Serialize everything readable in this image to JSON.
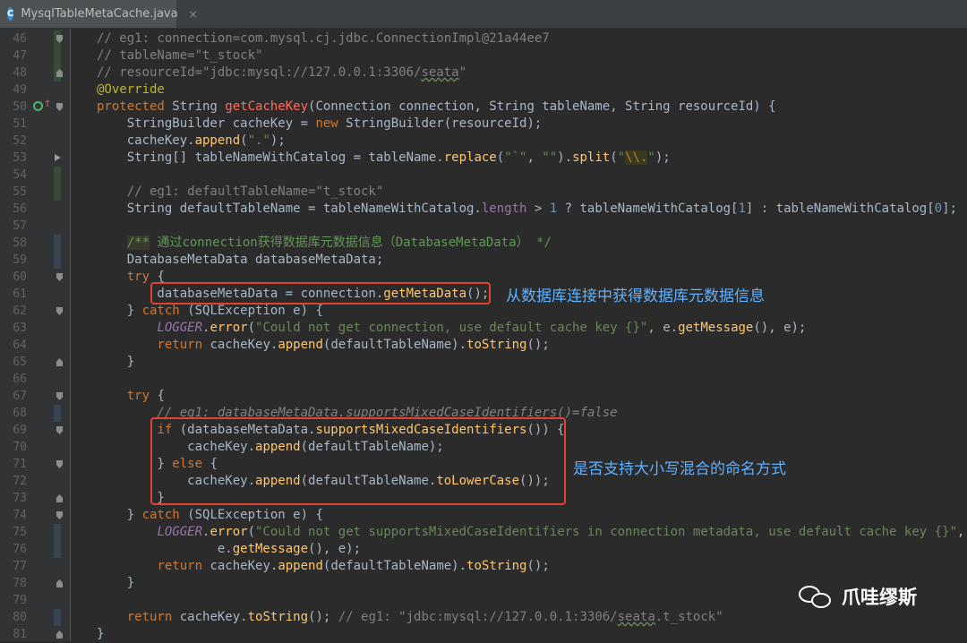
{
  "tab": {
    "icon": "C",
    "title": "MysqlTableMetaCache.java",
    "close": "×"
  },
  "gutter": {
    "line_numbers": [
      "46",
      "47",
      "48",
      "49",
      "50",
      "51",
      "52",
      "53",
      "54",
      "55",
      "56",
      "57",
      "58",
      "59",
      "60",
      "61",
      "62",
      "63",
      "64",
      "65",
      "66",
      "67",
      "68",
      "69",
      "70",
      "71",
      "72",
      "73",
      "74",
      "75",
      "76",
      "77",
      "78",
      "79",
      "80",
      "81"
    ]
  },
  "code": {
    "l46": "// eg1: connection=com.mysql.cj.jdbc.ConnectionImpl@21a44ee7",
    "l47": "// tableName=\"t_stock\"",
    "l48a": "// resourceId=\"jdbc:mysql://127.0.0.1:3306/",
    "l48b": "seata",
    "l48c": "\"",
    "l49": "@Override",
    "l50a": "protected",
    "l50b": " String ",
    "l50c": "getCacheKey",
    "l50d": "(Connection connection, String tableName, String resourceId) {",
    "l51a": "    StringBuilder cacheKey = ",
    "l51b": "new",
    "l51c": " StringBuilder(resourceId);",
    "l52a": "    cacheKey.",
    "l52b": "append",
    "l52c": "(",
    "l52d": "\".\"",
    "l52e": ");",
    "l53a": "    String[] tableNameWithCatalog = tableName.",
    "l53b": "replace",
    "l53c": "(",
    "l53d": "\"`\"",
    "l53e": ", ",
    "l53f": "\"\"",
    "l53g": ").",
    "l53h": "split",
    "l53i": "(",
    "l53j": "\"",
    "l53k": "\\\\.",
    "l53l": "\"",
    "l53m": ");",
    "l55": "    // eg1: defaultTableName=\"t_stock\"",
    "l56a": "    String defaultTableName = tableNameWithCatalog.",
    "l56b": "length",
    "l56c": " > ",
    "l56d": "1",
    "l56e": " ? tableNameWithCatalog[",
    "l56f": "1",
    "l56g": "] : tableNameWithCatalog[",
    "l56h": "0",
    "l56i": "];",
    "l58a": "    ",
    "l58b": "/**",
    "l58c": " 通过connection获得数据库元数据信息（DatabaseMetaData） */",
    "l59": "    DatabaseMetaData databaseMetaData;",
    "l60a": "    ",
    "l60b": "try",
    "l60c": " {",
    "l61a": "        databaseMetaData = connection.",
    "l61b": "getMetaData",
    "l61c": "();",
    "l62a": "    } ",
    "l62b": "catch",
    "l62c": " (SQLException e) {",
    "l63a": "        ",
    "l63b": "LOGGER",
    "l63c": ".",
    "l63d": "error",
    "l63e": "(",
    "l63f": "\"Could not get connection, use default cache key {}\"",
    "l63g": ", e.",
    "l63h": "getMessage",
    "l63i": "(), e);",
    "l64a": "        ",
    "l64b": "return",
    "l64c": " cacheKey.",
    "l64d": "append",
    "l64e": "(defaultTableName).",
    "l64f": "toString",
    "l64g": "();",
    "l65": "    }",
    "l67a": "    ",
    "l67b": "try",
    "l67c": " {",
    "l68": "        // eg1: databaseMetaData.supportsMixedCaseIdentifiers()=false",
    "l69a": "        ",
    "l69b": "if",
    "l69c": " (databaseMetaData.",
    "l69d": "supportsMixedCaseIdentifiers",
    "l69e": "()) {",
    "l70a": "            cacheKey.",
    "l70b": "append",
    "l70c": "(defaultTableName);",
    "l71a": "        } ",
    "l71b": "else",
    "l71c": " {",
    "l72a": "            cacheKey.",
    "l72b": "append",
    "l72c": "(defaultTableName.",
    "l72d": "toLowerCase",
    "l72e": "());",
    "l73": "        }",
    "l74a": "    } ",
    "l74b": "catch",
    "l74c": " (SQLException e) {",
    "l75a": "        ",
    "l75b": "LOGGER",
    "l75c": ".",
    "l75d": "error",
    "l75e": "(",
    "l75f": "\"Could not get supportsMixedCaseIdentifiers in connection metadata, use default cache key {}\"",
    "l75g": ",",
    "l76a": "                e.",
    "l76b": "getMessage",
    "l76c": "(), e);",
    "l77a": "        ",
    "l77b": "return",
    "l77c": " cacheKey.",
    "l77d": "append",
    "l77e": "(defaultTableName).",
    "l77f": "toString",
    "l77g": "();",
    "l78": "    }",
    "l80a": "    ",
    "l80b": "return",
    "l80c": " cacheKey.",
    "l80d": "toString",
    "l80e": "(); ",
    "l80f": "// eg1: \"jdbc:mysql://127.0.0.1:3306/",
    "l80g": "seata",
    "l80h": ".t_stock\"",
    "l81": "}"
  },
  "annotations": {
    "a1": "从数据库连接中获得数据库元数据信息",
    "a2": "是否支持大小写混合的命名方式"
  },
  "watermark": {
    "text": "爪哇缪斯",
    "icon": "wechat-icon"
  },
  "colors": {
    "keyword": "#cc7832",
    "string": "#6a8759",
    "comment": "#808080",
    "method": "#ffc66d",
    "field": "#9876aa",
    "number": "#6897bb",
    "highlight_box": "#e0442f",
    "annotation": "#5fb0ff"
  }
}
